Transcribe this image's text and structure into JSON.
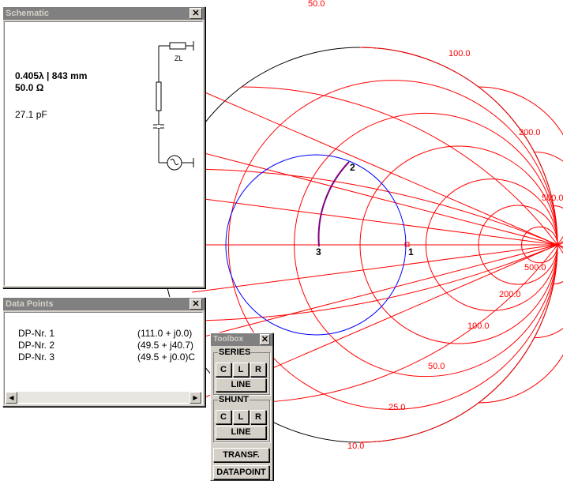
{
  "chart": {
    "outer_labels": [
      "50.0",
      "100.0",
      "200.0",
      "500.0"
    ],
    "inner_labels": [
      "500.0",
      "200.0",
      "100.0",
      "50.0",
      "25.0",
      "10.0"
    ],
    "points": [
      "1",
      "2",
      "3"
    ]
  },
  "schematic": {
    "title": "Schematic",
    "close": "✕",
    "line_length": "0.405λ | 843 mm",
    "impedance": "50.0  Ω",
    "capacitance": "27.1 pF",
    "zl_label": "ZL"
  },
  "datapoints": {
    "title": "Data Points",
    "close": "✕",
    "rows": [
      {
        "name": "DP-Nr. 1",
        "value": "(111.0 + j0.0)"
      },
      {
        "name": "DP-Nr. 2",
        "value": "(49.5 + j40.7)"
      },
      {
        "name": "DP-Nr. 3",
        "value": "(49.5 + j0.0)C"
      }
    ],
    "scroll_left": "◀",
    "scroll_right": "▶"
  },
  "toolbox": {
    "title": "Toolbox",
    "close": "✕",
    "series_label": "SERIES",
    "shunt_label": "SHUNT",
    "c": "C",
    "l": "L",
    "r": "R",
    "line": "LINE",
    "transf": "TRANSF.",
    "datapoint": "DATAPOINT"
  },
  "colors": {
    "grid": "#ff0000",
    "circle": "#0000ff",
    "arc": "#800080"
  }
}
